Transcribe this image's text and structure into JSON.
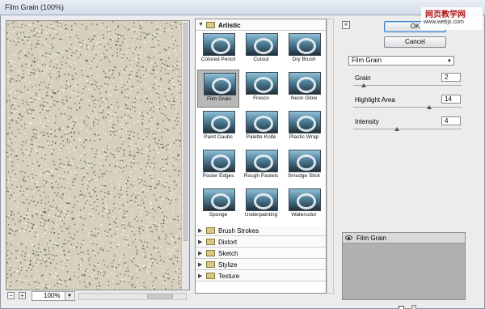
{
  "window": {
    "title": "Film Grain (100%)"
  },
  "preview": {
    "zoom_minus": "−",
    "zoom_plus": "+",
    "zoom": "100%"
  },
  "gallery": {
    "open_group": "Artistic",
    "filters": [
      {
        "name": "Colored Pencil"
      },
      {
        "name": "Cutout"
      },
      {
        "name": "Dry Brush"
      },
      {
        "name": "Film Grain",
        "selected": true
      },
      {
        "name": "Fresco"
      },
      {
        "name": "Neon Glow"
      },
      {
        "name": "Paint Daubs"
      },
      {
        "name": "Palette Knife"
      },
      {
        "name": "Plastic Wrap"
      },
      {
        "name": "Poster Edges"
      },
      {
        "name": "Rough Pastels"
      },
      {
        "name": "Smudge Stick"
      },
      {
        "name": "Sponge"
      },
      {
        "name": "Underpainting"
      },
      {
        "name": "Watercolor"
      }
    ],
    "groups": [
      "Brush Strokes",
      "Distort",
      "Sketch",
      "Stylize",
      "Texture"
    ]
  },
  "buttons": {
    "ok": "OK",
    "cancel": "Cancel"
  },
  "settings": {
    "filter": "Film Grain",
    "params": [
      {
        "label": "Grain",
        "value": "2",
        "max": 20
      },
      {
        "label": "Highlight Area",
        "value": "14",
        "max": 20
      },
      {
        "label": "Intensity",
        "value": "4",
        "max": 10
      }
    ]
  },
  "layers": {
    "items": [
      {
        "name": "Film Grain"
      }
    ]
  },
  "watermark": {
    "line1": "网页教学网",
    "line2": "www.webjx.com"
  }
}
